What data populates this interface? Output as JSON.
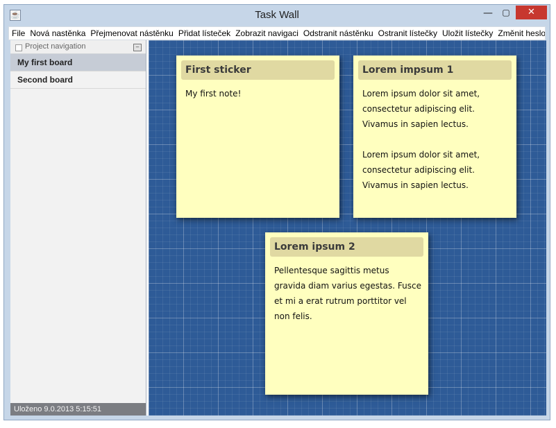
{
  "window": {
    "title": "Task Wall",
    "app_icon": "java-icon",
    "minimize": "—",
    "maximize": "▢",
    "close": "✕"
  },
  "menu": [
    "File",
    "Nová nastěnka",
    "Přejmenovat nástěnku",
    "Přidat lísteček",
    "Zobrazit navigaci",
    "Odstranit nástěnku",
    "Ostranit lístečky",
    "Uložit lístečky",
    "Změnit heslo"
  ],
  "sidebar": {
    "header": "Project navigation",
    "items": [
      {
        "label": "My first board",
        "selected": true
      },
      {
        "label": "Second board",
        "selected": false
      }
    ]
  },
  "status": "Uloženo 9.0.2013 5:15:51",
  "stickers": [
    {
      "title": "First sticker",
      "body": "My first note!"
    },
    {
      "title": "Lorem impsum 1",
      "body": "Lorem ipsum dolor sit amet,\nconsectetur adipiscing elit.\nVivamus in sapien lectus.\n\nLorem ipsum dolor sit amet,\nconsectetur adipiscing elit.\nVivamus in sapien lectus."
    },
    {
      "title": "Lorem ipsum 2",
      "body": "Pellentesque sagittis metus\ngravida diam varius egestas. Fusce\net mi a erat rutrum porttitor vel\nnon felis."
    }
  ],
  "colors": {
    "board": "#2e5b97",
    "sticker": "#ffffbf",
    "sticker_title": "#e0d9a2",
    "status_bar": "#7b7d82"
  }
}
